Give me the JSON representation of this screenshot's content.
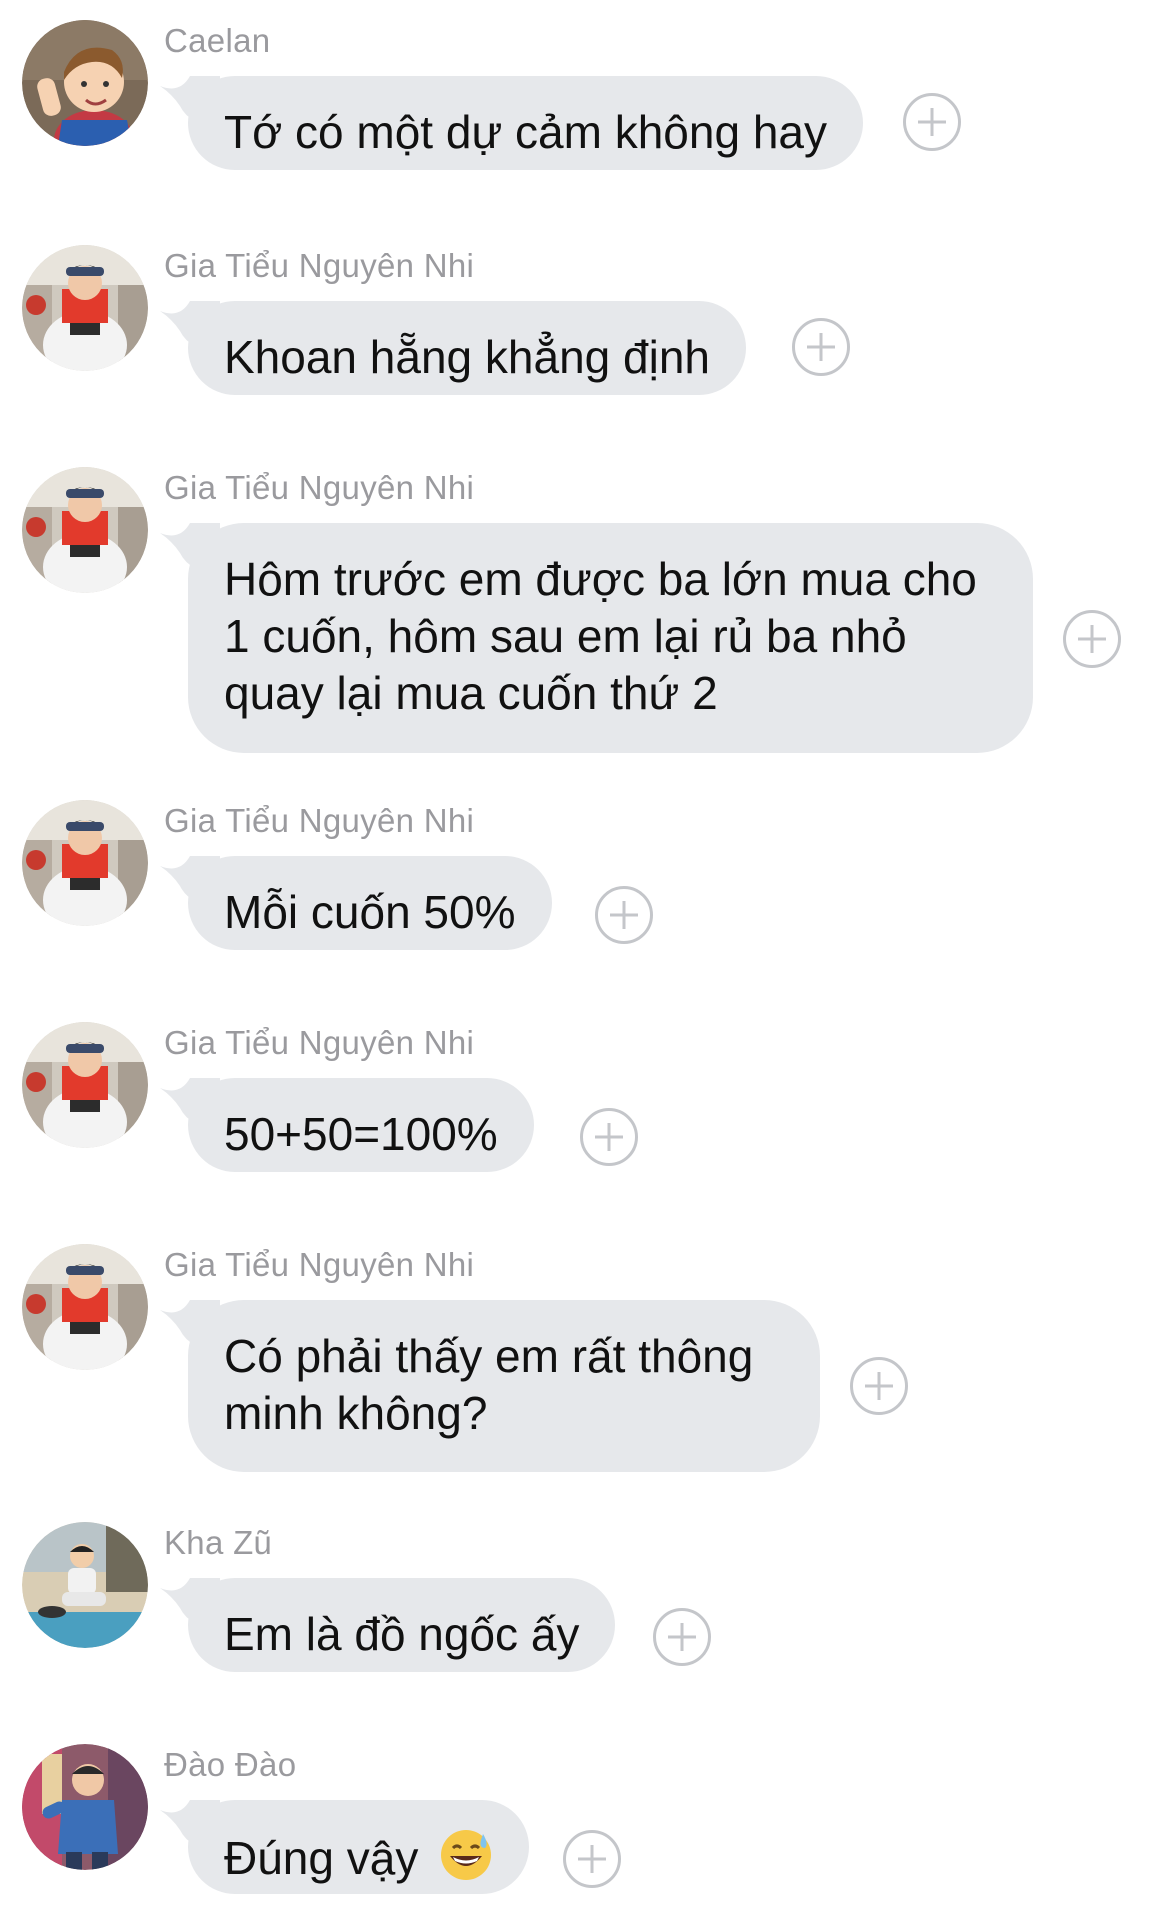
{
  "messages": [
    {
      "sender": "Caelan",
      "text": "Tớ có một dự cảm không hay",
      "avatar": "avatar-child-waving"
    },
    {
      "sender": "Gia Tiểu Nguyên Nhi",
      "text": "Khoan hẵng khẳng định",
      "avatar": "avatar-boy-red-shirt"
    },
    {
      "sender": "Gia Tiểu Nguyên Nhi",
      "text": "Hôm trước em được ba lớn mua cho 1 cuốn, hôm sau em lại rủ ba nhỏ quay lại mua cuốn thứ 2",
      "avatar": "avatar-boy-red-shirt"
    },
    {
      "sender": "Gia Tiểu Nguyên Nhi",
      "text": "Mỗi cuốn 50%",
      "avatar": "avatar-boy-red-shirt"
    },
    {
      "sender": "Gia Tiểu Nguyên Nhi",
      "text": "50+50=100%",
      "avatar": "avatar-boy-red-shirt"
    },
    {
      "sender": "Gia Tiểu Nguyên Nhi",
      "text": "Có phải thấy em rất thông minh không?",
      "avatar": "avatar-boy-red-shirt"
    },
    {
      "sender": "Kha Zũ",
      "text": "Em là đồ ngốc ấy",
      "avatar": "avatar-child-sitting"
    },
    {
      "sender": "Đào Đào",
      "text": "Đúng vậy",
      "avatar": "avatar-child-blue-jacket",
      "emoji": "grinning-sweat-emoji"
    }
  ],
  "colors": {
    "bubble": "#e6e8eb",
    "sender_name": "#9a9a9e",
    "message_text": "#111111",
    "add_reaction_icon": "#c4c6ca"
  },
  "icons": {
    "add_reaction": "plus-circle-icon"
  }
}
